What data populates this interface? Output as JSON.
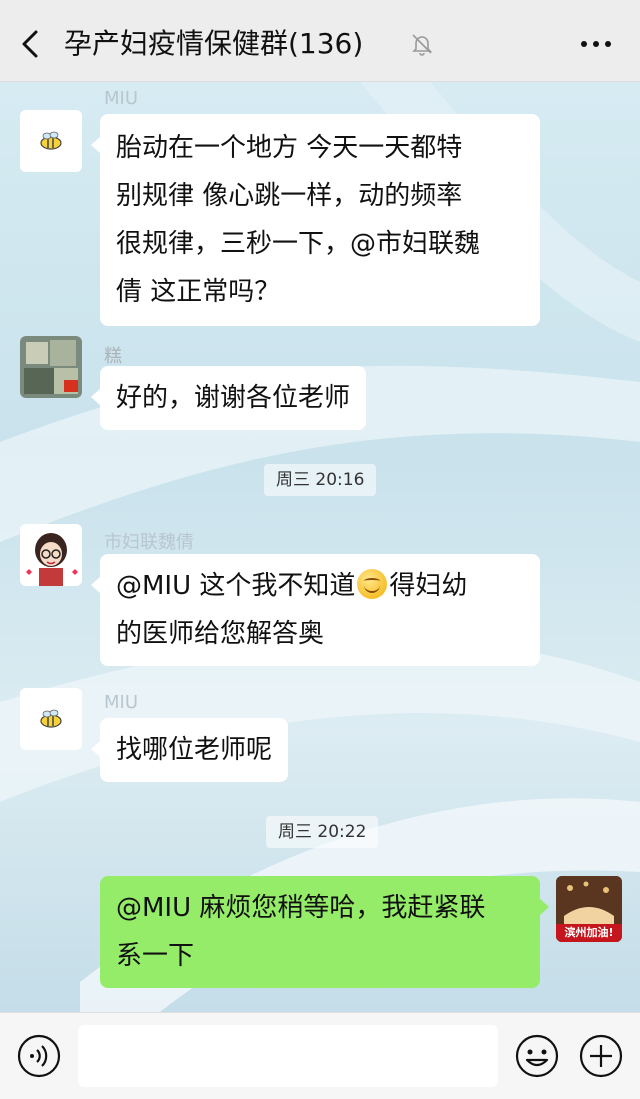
{
  "header": {
    "title": "孕产妇疫情保健群(136)"
  },
  "messages": [
    {
      "sender": "MIU",
      "text": "胎动在一个地方 今天一天都特别规律 像心跳一样，动的频率很规律，三秒一下，@市妇联魏倩  这正常吗？",
      "lines": [
        "胎动在一个地方 今天一天都特",
        "别规律 像心跳一样，动的频率",
        "很规律，三秒一下，@市妇联魏",
        "倩  这正常吗？"
      ]
    },
    {
      "sender": "糕",
      "text": "好的，谢谢各位老师"
    },
    {
      "sender": "市妇联魏倩",
      "line1_before": "@MIU  这个我不知道",
      "line1_after": "得妇幼",
      "line2": "的医师给您解答奥"
    },
    {
      "sender": "MIU",
      "text": "找哪位老师呢"
    },
    {
      "lines": [
        "@MIU  麻烦您稍等哈，我赶紧联",
        "系一下"
      ]
    }
  ],
  "timestamps": [
    "周三 20:16",
    "周三 20:22"
  ],
  "avatar_badge": "滨州加油!",
  "input": {
    "value": ""
  },
  "colors": {
    "header_bg": "#ededed",
    "bubble_own": "#95ec69",
    "bubble_other": "#ffffff"
  }
}
